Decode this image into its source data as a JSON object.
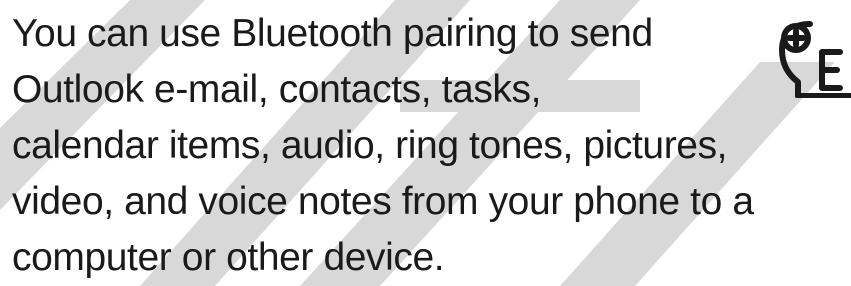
{
  "paragraph": {
    "lines": [
      "You can use Bluetooth pairing to send",
      "Outlook e-mail, contacts, tasks,",
      "calendar items, audio, ring tones, pictures,",
      "video, and voice notes from your phone to a",
      "computer or other device."
    ]
  },
  "icons": {
    "feature": "enhanced-feature-icon",
    "watermark": "draft-watermark"
  },
  "colors": {
    "text": "#1a1a1a",
    "watermark": "#d8d8d8",
    "icon": "#1a1a1a",
    "background": "#ffffff"
  }
}
